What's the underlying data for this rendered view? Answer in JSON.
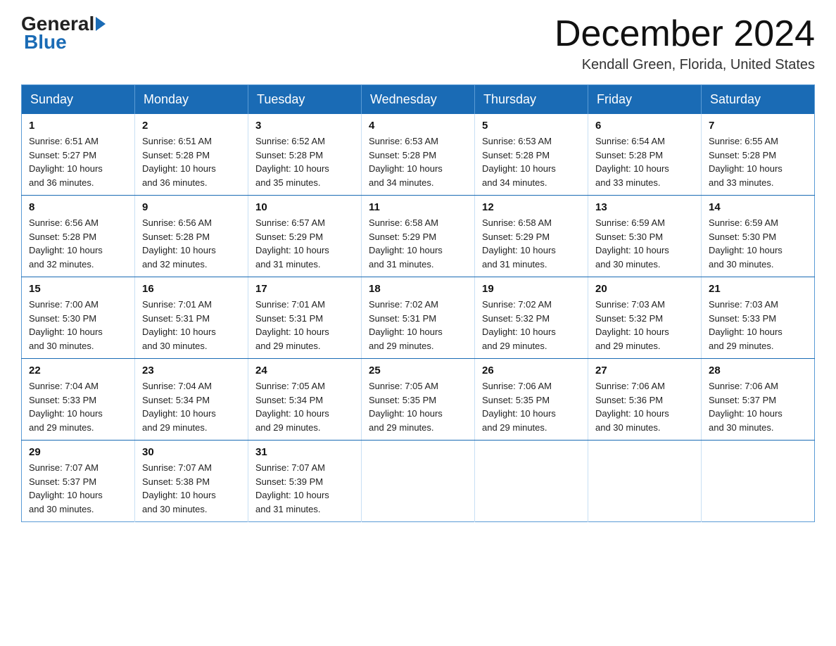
{
  "logo": {
    "general": "General",
    "blue": "Blue"
  },
  "title": "December 2024",
  "location": "Kendall Green, Florida, United States",
  "days_of_week": [
    "Sunday",
    "Monday",
    "Tuesday",
    "Wednesday",
    "Thursday",
    "Friday",
    "Saturday"
  ],
  "weeks": [
    [
      {
        "day": "1",
        "sunrise": "6:51 AM",
        "sunset": "5:27 PM",
        "daylight": "10 hours and 36 minutes."
      },
      {
        "day": "2",
        "sunrise": "6:51 AM",
        "sunset": "5:28 PM",
        "daylight": "10 hours and 36 minutes."
      },
      {
        "day": "3",
        "sunrise": "6:52 AM",
        "sunset": "5:28 PM",
        "daylight": "10 hours and 35 minutes."
      },
      {
        "day": "4",
        "sunrise": "6:53 AM",
        "sunset": "5:28 PM",
        "daylight": "10 hours and 34 minutes."
      },
      {
        "day": "5",
        "sunrise": "6:53 AM",
        "sunset": "5:28 PM",
        "daylight": "10 hours and 34 minutes."
      },
      {
        "day": "6",
        "sunrise": "6:54 AM",
        "sunset": "5:28 PM",
        "daylight": "10 hours and 33 minutes."
      },
      {
        "day": "7",
        "sunrise": "6:55 AM",
        "sunset": "5:28 PM",
        "daylight": "10 hours and 33 minutes."
      }
    ],
    [
      {
        "day": "8",
        "sunrise": "6:56 AM",
        "sunset": "5:28 PM",
        "daylight": "10 hours and 32 minutes."
      },
      {
        "day": "9",
        "sunrise": "6:56 AM",
        "sunset": "5:28 PM",
        "daylight": "10 hours and 32 minutes."
      },
      {
        "day": "10",
        "sunrise": "6:57 AM",
        "sunset": "5:29 PM",
        "daylight": "10 hours and 31 minutes."
      },
      {
        "day": "11",
        "sunrise": "6:58 AM",
        "sunset": "5:29 PM",
        "daylight": "10 hours and 31 minutes."
      },
      {
        "day": "12",
        "sunrise": "6:58 AM",
        "sunset": "5:29 PM",
        "daylight": "10 hours and 31 minutes."
      },
      {
        "day": "13",
        "sunrise": "6:59 AM",
        "sunset": "5:30 PM",
        "daylight": "10 hours and 30 minutes."
      },
      {
        "day": "14",
        "sunrise": "6:59 AM",
        "sunset": "5:30 PM",
        "daylight": "10 hours and 30 minutes."
      }
    ],
    [
      {
        "day": "15",
        "sunrise": "7:00 AM",
        "sunset": "5:30 PM",
        "daylight": "10 hours and 30 minutes."
      },
      {
        "day": "16",
        "sunrise": "7:01 AM",
        "sunset": "5:31 PM",
        "daylight": "10 hours and 30 minutes."
      },
      {
        "day": "17",
        "sunrise": "7:01 AM",
        "sunset": "5:31 PM",
        "daylight": "10 hours and 29 minutes."
      },
      {
        "day": "18",
        "sunrise": "7:02 AM",
        "sunset": "5:31 PM",
        "daylight": "10 hours and 29 minutes."
      },
      {
        "day": "19",
        "sunrise": "7:02 AM",
        "sunset": "5:32 PM",
        "daylight": "10 hours and 29 minutes."
      },
      {
        "day": "20",
        "sunrise": "7:03 AM",
        "sunset": "5:32 PM",
        "daylight": "10 hours and 29 minutes."
      },
      {
        "day": "21",
        "sunrise": "7:03 AM",
        "sunset": "5:33 PM",
        "daylight": "10 hours and 29 minutes."
      }
    ],
    [
      {
        "day": "22",
        "sunrise": "7:04 AM",
        "sunset": "5:33 PM",
        "daylight": "10 hours and 29 minutes."
      },
      {
        "day": "23",
        "sunrise": "7:04 AM",
        "sunset": "5:34 PM",
        "daylight": "10 hours and 29 minutes."
      },
      {
        "day": "24",
        "sunrise": "7:05 AM",
        "sunset": "5:34 PM",
        "daylight": "10 hours and 29 minutes."
      },
      {
        "day": "25",
        "sunrise": "7:05 AM",
        "sunset": "5:35 PM",
        "daylight": "10 hours and 29 minutes."
      },
      {
        "day": "26",
        "sunrise": "7:06 AM",
        "sunset": "5:35 PM",
        "daylight": "10 hours and 29 minutes."
      },
      {
        "day": "27",
        "sunrise": "7:06 AM",
        "sunset": "5:36 PM",
        "daylight": "10 hours and 30 minutes."
      },
      {
        "day": "28",
        "sunrise": "7:06 AM",
        "sunset": "5:37 PM",
        "daylight": "10 hours and 30 minutes."
      }
    ],
    [
      {
        "day": "29",
        "sunrise": "7:07 AM",
        "sunset": "5:37 PM",
        "daylight": "10 hours and 30 minutes."
      },
      {
        "day": "30",
        "sunrise": "7:07 AM",
        "sunset": "5:38 PM",
        "daylight": "10 hours and 30 minutes."
      },
      {
        "day": "31",
        "sunrise": "7:07 AM",
        "sunset": "5:39 PM",
        "daylight": "10 hours and 31 minutes."
      },
      null,
      null,
      null,
      null
    ]
  ],
  "labels": {
    "sunrise": "Sunrise:",
    "sunset": "Sunset:",
    "daylight": "Daylight:"
  }
}
